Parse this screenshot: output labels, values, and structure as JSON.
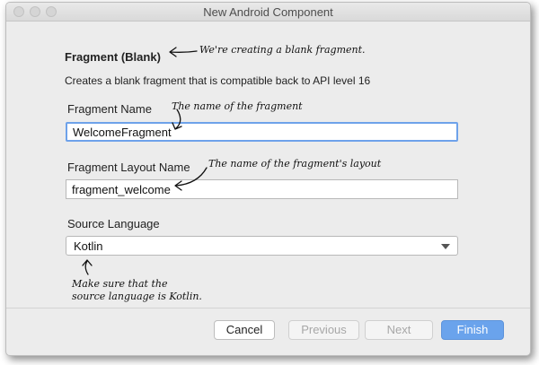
{
  "window": {
    "title": "New Android Component"
  },
  "form": {
    "heading": "Fragment (Blank)",
    "description": "Creates a blank fragment that is compatible back to API level 16",
    "fragment_name_label": "Fragment Name",
    "fragment_name_value": "WelcomeFragment",
    "layout_name_label": "Fragment Layout Name",
    "layout_name_value": "fragment_welcome",
    "source_language_label": "Source Language",
    "source_language_value": "Kotlin"
  },
  "buttons": {
    "cancel": "Cancel",
    "previous": "Previous",
    "next": "Next",
    "finish": "Finish"
  },
  "annotations": {
    "heading_note": "We're creating a blank fragment.",
    "name_note": "The name of the fragment",
    "layout_note": "The name of the fragment's layout",
    "language_note_line1": "Make sure that the",
    "language_note_line2": "source language is Kotlin."
  },
  "colors": {
    "focus_border": "#6ea2ea",
    "finish_button": "#6aa3ec",
    "disabled_text": "#a7a7a7"
  },
  "icons": {
    "dropdown": "chevron-down-icon"
  }
}
